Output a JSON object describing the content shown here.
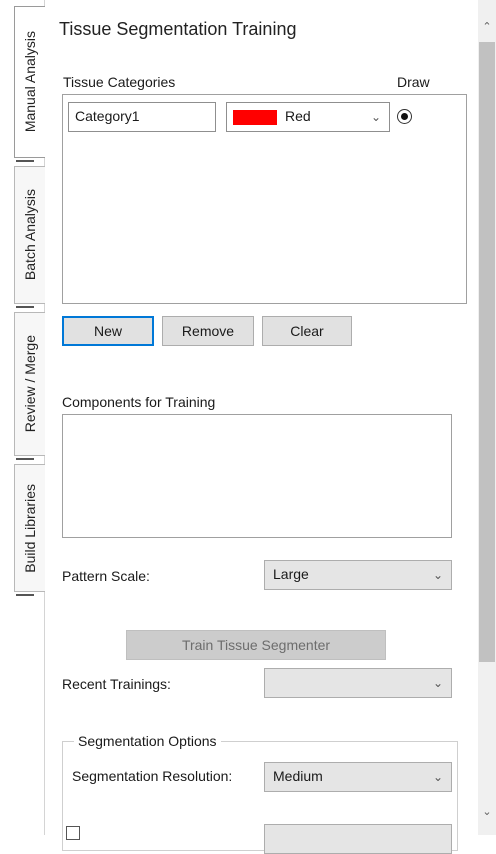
{
  "vertical_tabs": [
    {
      "label": "Manual Analysis",
      "active": true
    },
    {
      "label": "Batch Analysis",
      "active": false
    },
    {
      "label": "Review / Merge",
      "active": false
    },
    {
      "label": "Build Libraries",
      "active": false
    }
  ],
  "panel": {
    "title": "Tissue Segmentation Training",
    "categories_label": "Tissue Categories",
    "draw_label": "Draw",
    "category_row": {
      "name": "Category1",
      "color_name": "Red",
      "color_hex": "#ff0000",
      "draw_selected": true
    },
    "buttons": {
      "new": "New",
      "remove": "Remove",
      "clear": "Clear"
    },
    "components_label": "Components for Training",
    "pattern_scale_label": "Pattern Scale:",
    "pattern_scale_value": "Large",
    "train_button": "Train Tissue Segmenter",
    "recent_trainings_label": "Recent Trainings:",
    "recent_trainings_value": "",
    "segmentation_options": {
      "title": "Segmentation Options",
      "resolution_label": "Segmentation Resolution:",
      "resolution_value": "Medium"
    }
  },
  "icons": {
    "dropdown": "chevron-down-icon",
    "scroll_up": "scroll-up-arrow-icon",
    "scroll_down": "scroll-down-arrow-icon"
  },
  "colors": {
    "accent_focus": "#0078d7",
    "swatch_red": "#ff0000"
  }
}
